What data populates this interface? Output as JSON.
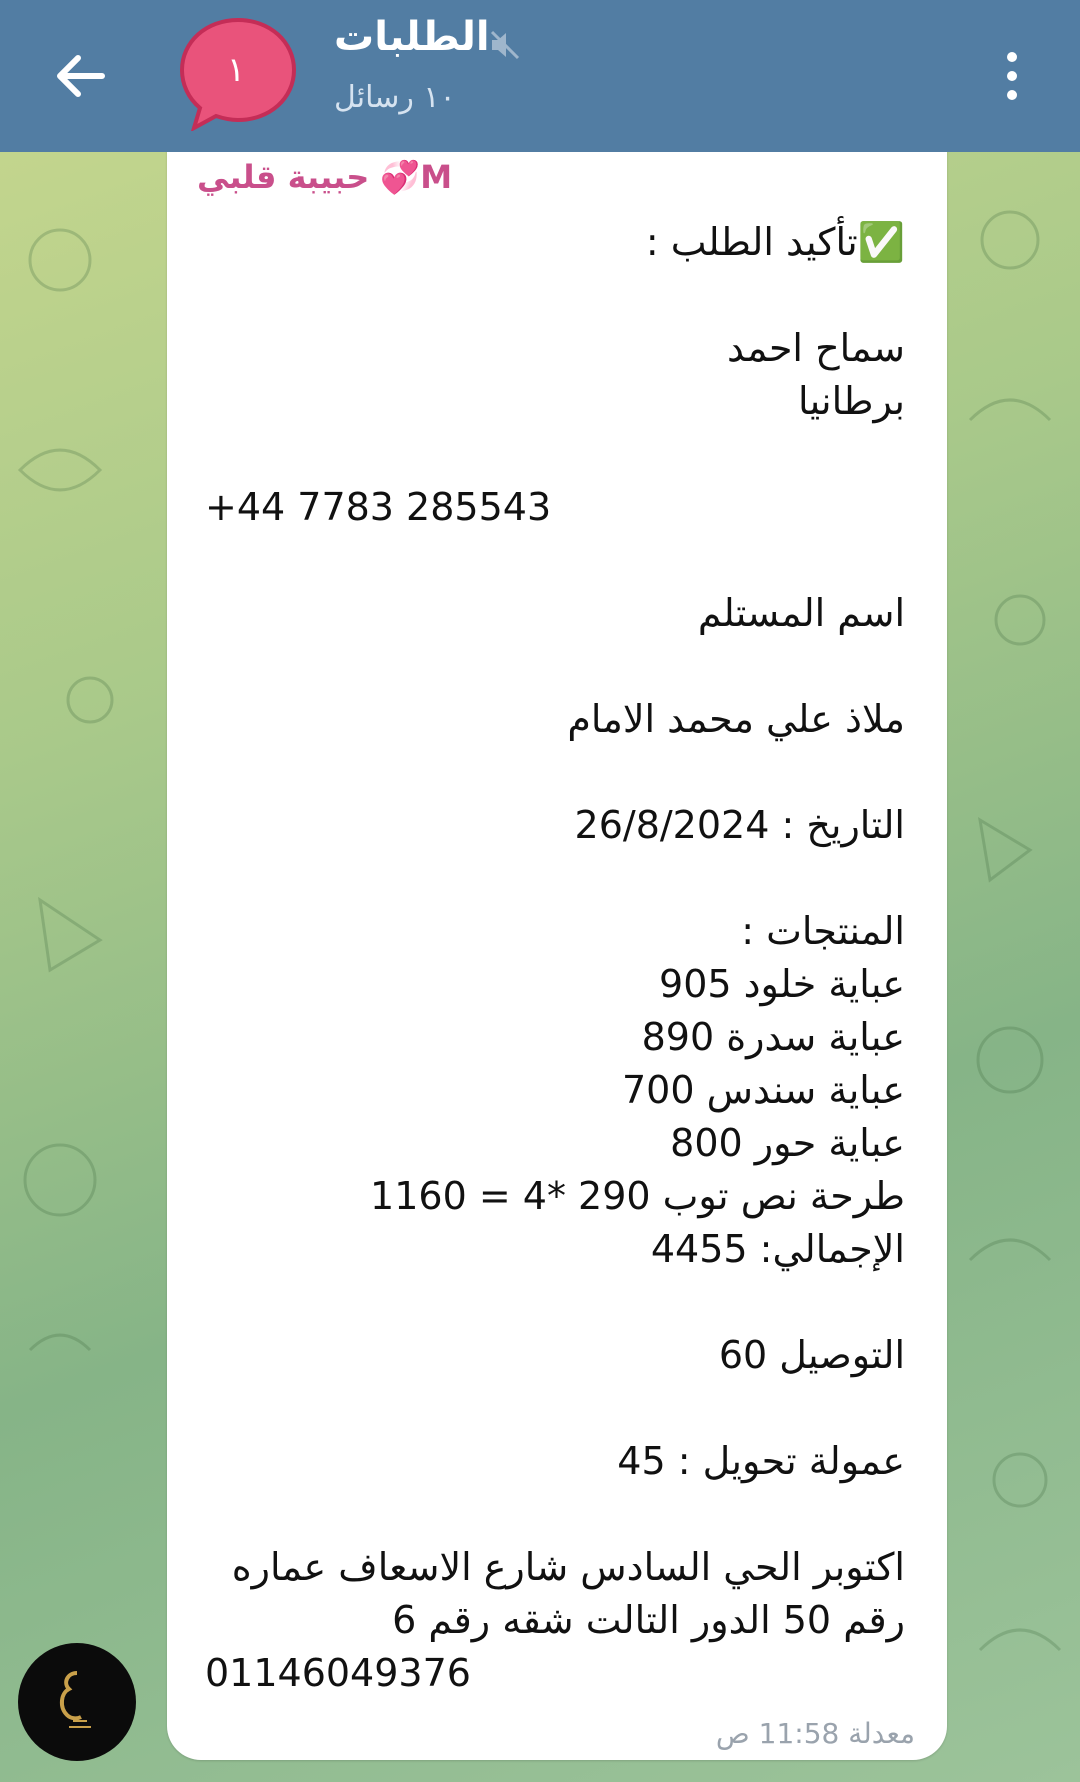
{
  "header": {
    "title": "الطلبات",
    "subtitle": "١٠ رسائل",
    "avatar_text": "١",
    "avatar_color": "#e9537b",
    "bar_color": "#527da3"
  },
  "message": {
    "sender": "حبيبة قلبي 💞M",
    "sender_color": "#c94f8b",
    "lines": [
      "✅تأكيد الطلب :",
      "",
      "سماح احمد",
      "برطانيا",
      "",
      "+44 7783 285543",
      "",
      "اسم المستلم",
      "",
      "ملاذ علي محمد الامام",
      "",
      "التاريخ : 26/8/2024",
      "",
      "المنتجات :",
      "عباية خلود 905",
      "عباية سدرة 890",
      "عباية سندس 700",
      "عباية حور 800",
      "طرحة نص توب 290 *4 = 1160",
      "الإجمالي: 4455",
      "",
      "التوصيل 60",
      "",
      "عمولة تحويل : 45",
      "",
      "اكتوبر الحي السادس شارع الاسعاف عماره",
      "رقم 50 الدور التالت شقه رقم 6",
      "01146049376"
    ],
    "meta": "معدلة 11:58 ص"
  }
}
